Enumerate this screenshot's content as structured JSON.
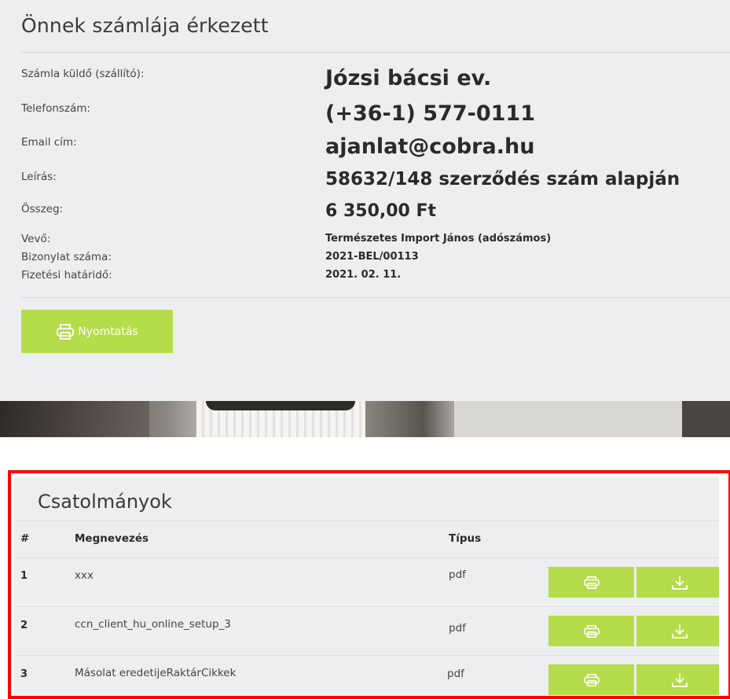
{
  "invoice": {
    "title": "Önnek számlája érkezett",
    "fields": {
      "sender_label": "Számla küldő (szállító):",
      "sender_value": "Józsi bácsi ev.",
      "phone_label": "Telefonszám:",
      "phone_value": "(+36-1) 577-0111",
      "email_label": "Email cím:",
      "email_value": "ajanlat@cobra.hu",
      "desc_label": "Leírás:",
      "desc_value": "58632/148 szerződés szám alapján",
      "amount_label": "Összeg:",
      "amount_value": "6 350,00 Ft",
      "buyer_label": "Vevő:",
      "buyer_value": "Természetes Import János (adószámos)",
      "doc_no_label": "Bizonylat száma:",
      "doc_no_value": "2021-BEL/00113",
      "due_label": "Fizetési határidő:",
      "due_value": "2021. 02. 11."
    },
    "print_button_label": "Nyomtatás"
  },
  "attachments": {
    "title": "Csatolmányok",
    "columns": [
      "#",
      "Megnevezés",
      "Típus"
    ],
    "rows": [
      {
        "num": "1",
        "name": "xxx",
        "type": "pdf"
      },
      {
        "num": "2",
        "name": "ccn_client_hu_online_setup_3",
        "type": "pdf"
      },
      {
        "num": "3",
        "name": "Másolat eredetijeRaktárCikkek",
        "type": "pdf"
      }
    ]
  },
  "icons": {
    "print": "printer-icon",
    "download": "download-icon"
  },
  "colors": {
    "accent_green": "#b5dd4b",
    "panel_bg": "#eceef0",
    "highlight_border": "#ff0000"
  }
}
